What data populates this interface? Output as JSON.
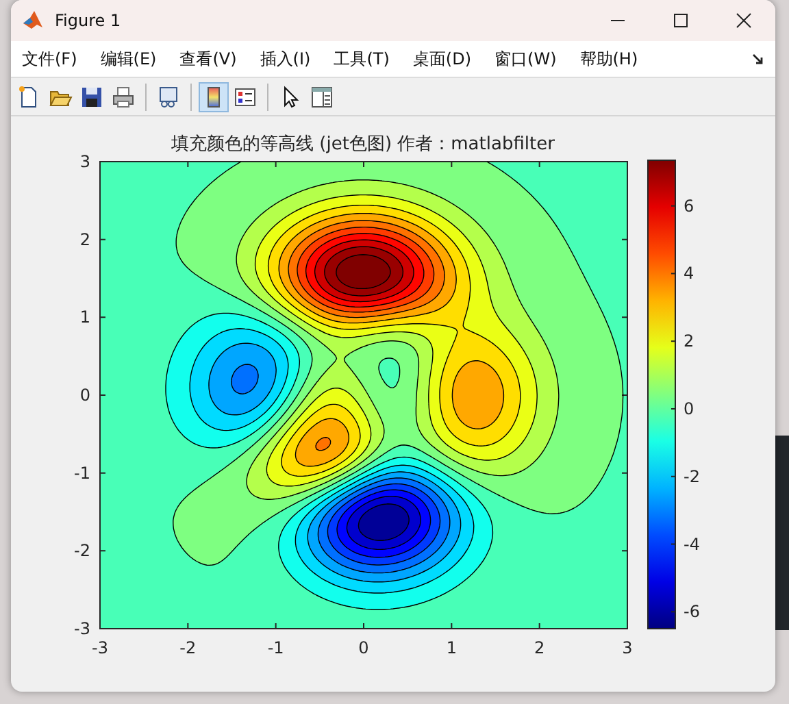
{
  "window": {
    "title": "Figure 1"
  },
  "menu": [
    "文件(F)",
    "编辑(E)",
    "查看(V)",
    "插入(I)",
    "工具(T)",
    "桌面(D)",
    "窗口(W)",
    "帮助(H)"
  ],
  "toolbar": [
    {
      "kind": "new",
      "selected": false
    },
    {
      "kind": "open",
      "selected": false
    },
    {
      "kind": "save",
      "selected": false
    },
    {
      "kind": "print",
      "selected": false
    },
    {
      "kind": "sep"
    },
    {
      "kind": "link",
      "selected": false
    },
    {
      "kind": "sep"
    },
    {
      "kind": "colorbar",
      "selected": true
    },
    {
      "kind": "legend",
      "selected": false
    },
    {
      "kind": "sep"
    },
    {
      "kind": "pointer",
      "selected": false
    },
    {
      "kind": "inspector",
      "selected": false
    }
  ],
  "plot": {
    "title": "填充颜色的等高线 (jet色图) 作者：matlabfilter",
    "xticks": [
      "-3",
      "-2",
      "-1",
      "0",
      "1",
      "2",
      "3"
    ],
    "yticks": [
      "3",
      "2",
      "1",
      "0",
      "-1",
      "-2",
      "-3"
    ],
    "colorbar_ticks": [
      "6",
      "4",
      "2",
      "0",
      "-2",
      "-4",
      "-6"
    ]
  }
}
